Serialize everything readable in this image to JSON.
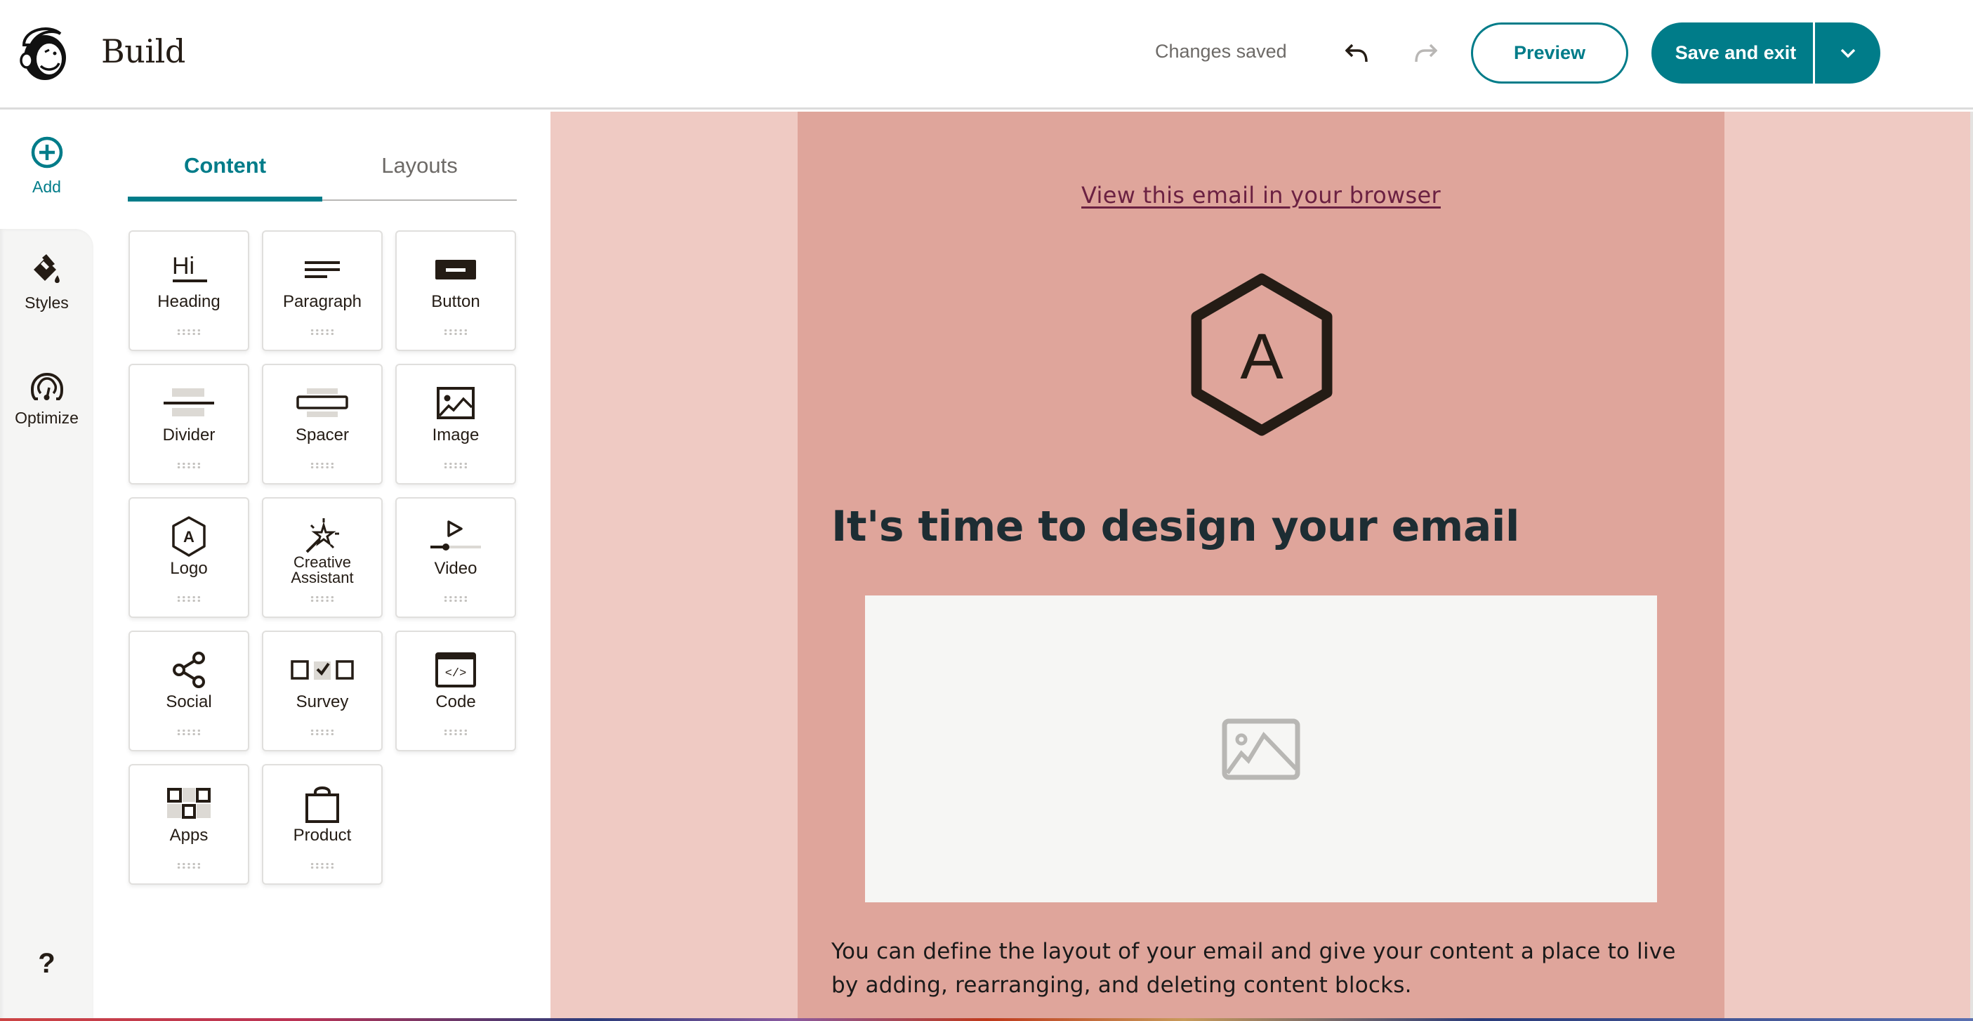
{
  "header": {
    "title": "Build",
    "logo": "mailchimp-freddie-logo",
    "save_status": "Changes saved",
    "undo_icon": "undo-icon",
    "redo_icon": "redo-icon",
    "preview_label": "Preview",
    "save_label": "Save and exit",
    "save_menu_icon": "chevron-down-icon"
  },
  "rail": {
    "items": [
      {
        "id": "add",
        "label": "Add",
        "icon": "plus-circle-icon",
        "active": true
      },
      {
        "id": "styles",
        "label": "Styles",
        "icon": "paint-bucket-icon"
      },
      {
        "id": "optimize",
        "label": "Optimize",
        "icon": "gauge-icon"
      }
    ],
    "help_label": "?"
  },
  "panel": {
    "tabs": [
      {
        "label": "Content",
        "active": true
      },
      {
        "label": "Layouts",
        "active": false
      }
    ],
    "blocks": [
      {
        "label": "Heading",
        "icon": "heading-icon"
      },
      {
        "label": "Paragraph",
        "icon": "paragraph-icon"
      },
      {
        "label": "Button",
        "icon": "button-icon"
      },
      {
        "label": "Divider",
        "icon": "divider-icon"
      },
      {
        "label": "Spacer",
        "icon": "spacer-icon"
      },
      {
        "label": "Image",
        "icon": "image-icon"
      },
      {
        "label": "Logo",
        "icon": "logo-hexagon-icon"
      },
      {
        "label": "Creative Assistant",
        "icon": "magic-wand-icon"
      },
      {
        "label": "Video",
        "icon": "video-icon"
      },
      {
        "label": "Social",
        "icon": "share-icon"
      },
      {
        "label": "Survey",
        "icon": "survey-icon"
      },
      {
        "label": "Code",
        "icon": "code-icon"
      },
      {
        "label": "Apps",
        "icon": "apps-icon"
      },
      {
        "label": "Product",
        "icon": "shopping-bag-icon"
      }
    ]
  },
  "email": {
    "view_in_browser": "View this email in your browser",
    "logo_letter": "A",
    "heading": "It's time to design your email",
    "image_placeholder_icon": "image-placeholder-icon",
    "paragraph": "You can define the layout of your email and give your content a place to live by adding, rearranging, and deleting content blocks."
  },
  "colors": {
    "brand": "#007c89",
    "canvas_background": "#efcac3",
    "email_background": "#dfa59b",
    "link": "#6b2142",
    "heading": "#1d2d33"
  }
}
